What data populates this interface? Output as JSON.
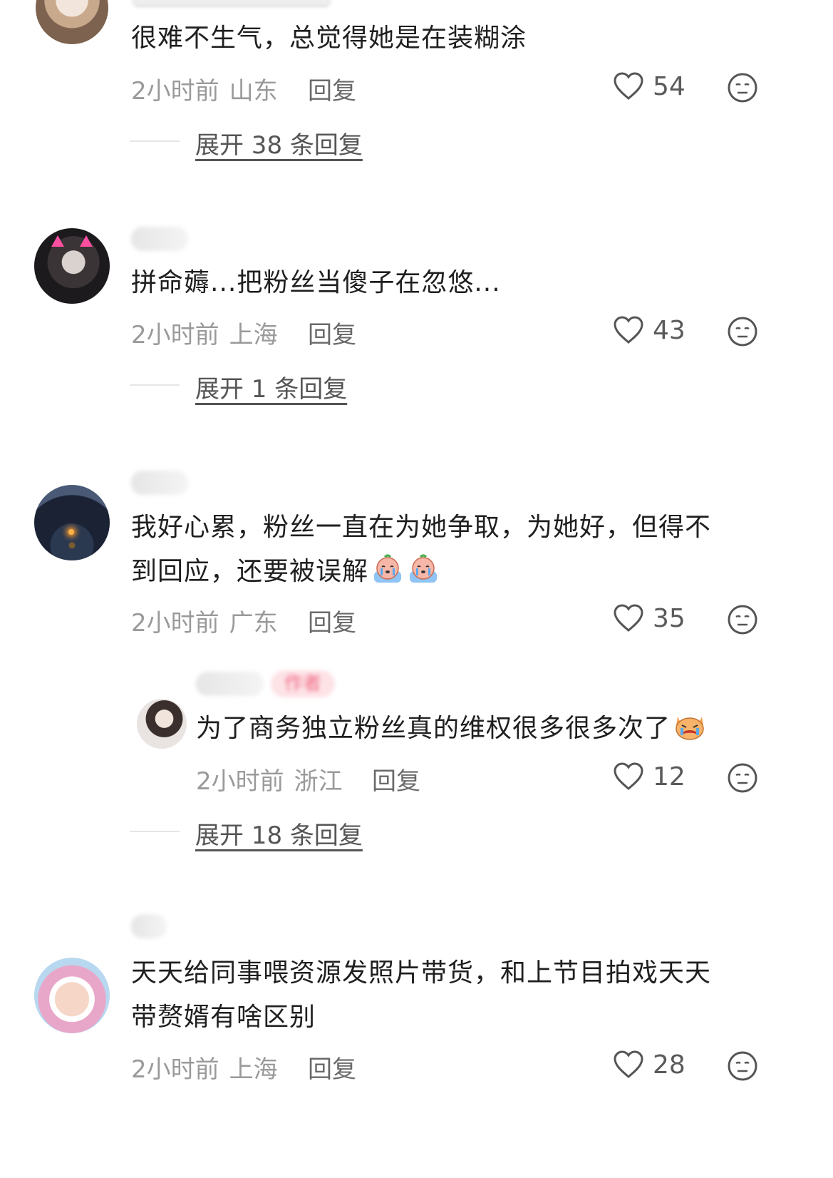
{
  "comments": [
    {
      "username": "",
      "text": "很难不生气，总觉得她是在装糊涂",
      "time": "2小时前",
      "location": "山东",
      "reply_label": "回复",
      "likes": "54",
      "expand_label": "展开 38 条回复"
    },
    {
      "username": "",
      "text": "拼命薅...把粉丝当傻子在忽悠...",
      "time": "2小时前",
      "location": "上海",
      "reply_label": "回复",
      "likes": "43",
      "expand_label": "展开 1 条回复"
    },
    {
      "username": "",
      "text_line1": "我好心累，粉丝一直在为她争取，为她好，但得不",
      "text_line2": "到回应，还要被误解",
      "time": "2小时前",
      "location": "广东",
      "reply_label": "回复",
      "likes": "35",
      "reply": {
        "username": "",
        "tag": "作者",
        "text": "为了商务独立粉丝真的维权很多很多次了",
        "time": "2小时前",
        "location": "浙江",
        "reply_label": "回复",
        "likes": "12"
      },
      "expand_label": "展开 18 条回复"
    },
    {
      "username": "",
      "text_line1": "天天给同事喂资源发照片带货，和上节目拍戏天天",
      "text_line2": "带赘婿有啥区别",
      "time": "2小时前",
      "location": "上海",
      "reply_label": "回复",
      "likes": "28"
    }
  ],
  "icons": {
    "like": "heart-outline-icon",
    "dislike": "neutral-face-icon",
    "emoji_cry": "crying-emoji",
    "emoji_cat": "angry-cat-emoji"
  },
  "colors": {
    "text": "#1f1f1f",
    "meta": "#9a9a9a",
    "author_tag_bg": "#fde2e6"
  }
}
